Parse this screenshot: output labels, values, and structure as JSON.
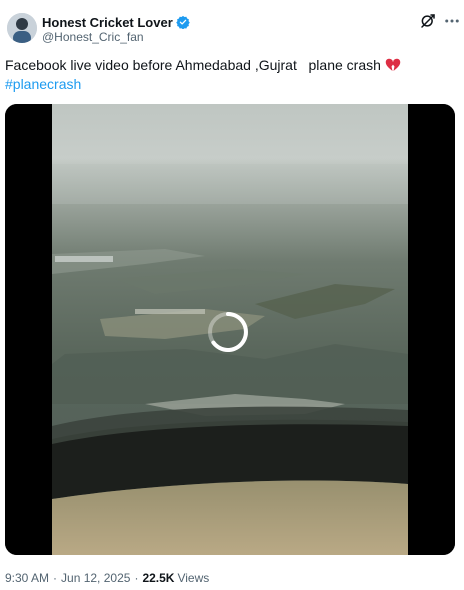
{
  "author": {
    "display_name": "Honest Cricket Lover",
    "handle": "@Honest_Cric_fan",
    "verified": true,
    "verified_color": "#1d9bf0"
  },
  "tweet": {
    "text_main": "Facebook live video before Ahmedabad ,Gujrat   plane crash",
    "emoji": "broken-heart",
    "hashtag": "#planecrash",
    "hashtag_color": "#1d9bf0"
  },
  "media": {
    "type": "video",
    "state": "loading"
  },
  "meta": {
    "time": "9:30 AM",
    "date": "Jun 12, 2025",
    "separator": "·",
    "views_count": "22.5K",
    "views_label": "Views"
  },
  "icons": {
    "grok": "grok-icon",
    "more": "more-options-icon"
  }
}
